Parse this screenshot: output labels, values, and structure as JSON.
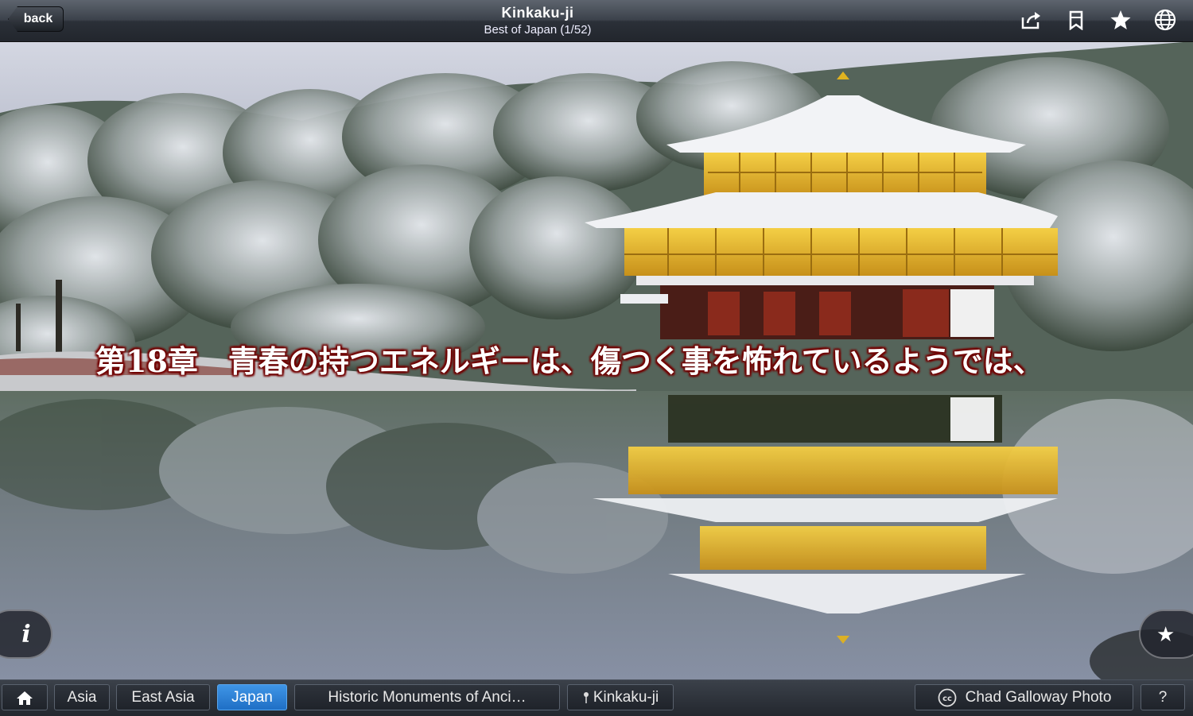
{
  "topbar": {
    "back_label": "back",
    "title": "Kinkaku-ji",
    "subtitle": "Best of Japan (1/52)",
    "icons": [
      "share-icon",
      "bookmark-icon",
      "star-icon",
      "globe-icon"
    ]
  },
  "photo": {
    "caption": "第18章　青春の持つエネルギーは、傷つく事を怖れているようでは、"
  },
  "buttons": {
    "info_label": "i",
    "fav_label": "★"
  },
  "breadcrumbs": {
    "home_icon": "home-icon",
    "items": [
      "Asia",
      "East Asia",
      "Japan",
      "Historic Monuments of Anci…",
      "Kinkaku-ji"
    ],
    "active": "Japan",
    "credit": "Chad Galloway Photo",
    "help": "?"
  },
  "colors": {
    "active_crumb": "#2a80d6",
    "caption_outline": "#7a0000",
    "temple_gold": "#e0b220"
  }
}
